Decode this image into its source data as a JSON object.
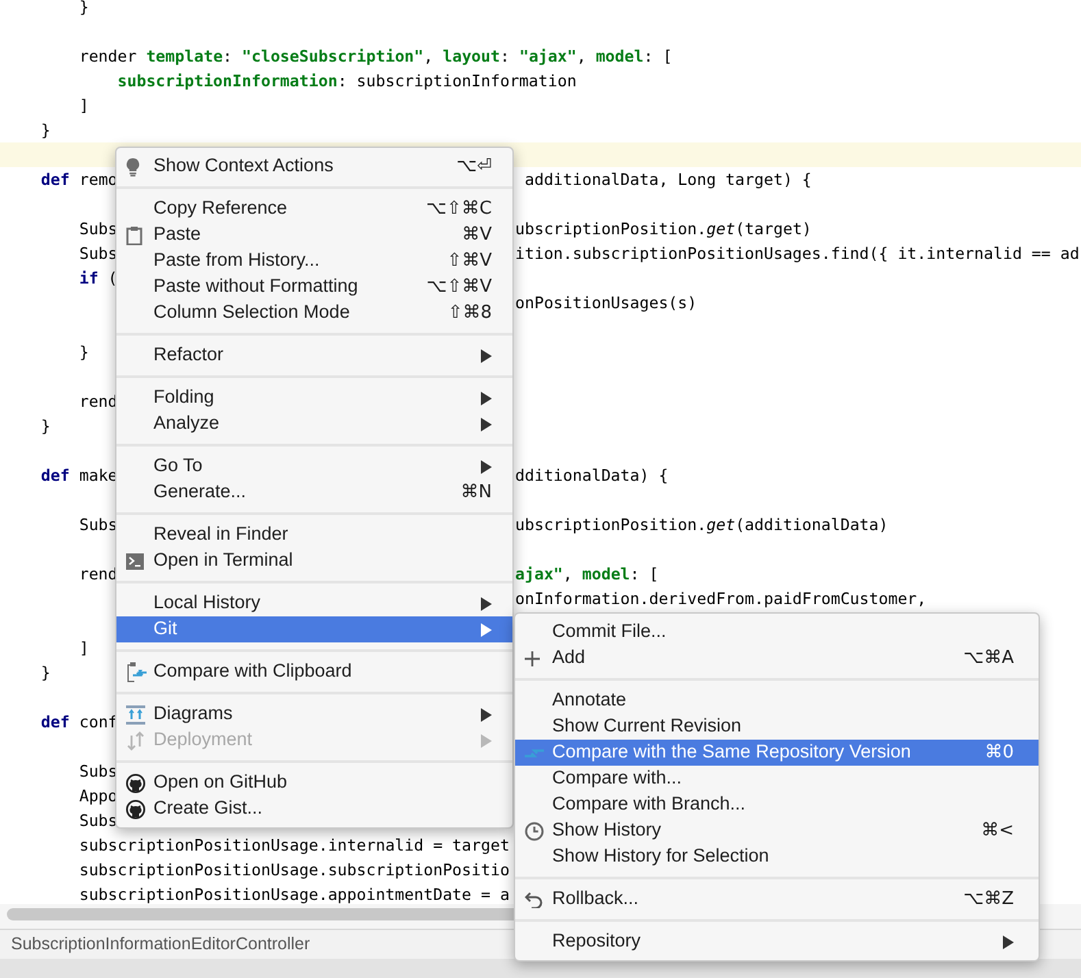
{
  "editor": {
    "lines": [
      {
        "kind": "code",
        "current": false,
        "left": [
          {
            "t": "        }"
          }
        ]
      },
      {
        "kind": "blank",
        "current": false
      },
      {
        "kind": "code",
        "current": false,
        "left": [
          {
            "t": "        render "
          },
          {
            "t": "template",
            "kind": "key"
          },
          {
            "t": ": "
          },
          {
            "t": "\"closeSubscription\"",
            "kind": "str"
          },
          {
            "t": ", "
          },
          {
            "t": "layout",
            "kind": "key"
          },
          {
            "t": ": "
          },
          {
            "t": "\"ajax\"",
            "kind": "str"
          },
          {
            "t": ", "
          },
          {
            "t": "model",
            "kind": "key"
          },
          {
            "t": ": ["
          }
        ]
      },
      {
        "kind": "code",
        "current": false,
        "left": [
          {
            "t": "            subscriptionInformation",
            "kind": "key"
          },
          {
            "t": ": subscriptionInformation"
          }
        ]
      },
      {
        "kind": "code",
        "current": false,
        "left": [
          {
            "t": "        ]"
          }
        ]
      },
      {
        "kind": "code",
        "current": false,
        "left": [
          {
            "t": "    }"
          }
        ]
      },
      {
        "kind": "blank",
        "current": true
      },
      {
        "kind": "code",
        "current": false,
        "left": [
          {
            "t": "    def",
            "kind": "kw"
          },
          {
            "t": " remo"
          }
        ],
        "right": [
          {
            "t": " additionalData, Long target) {"
          }
        ]
      },
      {
        "kind": "blank",
        "current": false
      },
      {
        "kind": "code",
        "current": false,
        "left": [
          {
            "t": "        Subs"
          }
        ],
        "right": [
          {
            "t": "ubscriptionPosition."
          },
          {
            "t": "get",
            "kind": "it"
          },
          {
            "t": "(target)"
          }
        ]
      },
      {
        "kind": "code",
        "current": false,
        "left": [
          {
            "t": "        Subs"
          }
        ],
        "right": [
          {
            "t": "ition.subscriptionPositionUsages.find({ it.internalid == ad"
          }
        ]
      },
      {
        "kind": "code",
        "current": false,
        "left": [
          {
            "t": "        if",
            "kind": "kw"
          },
          {
            "t": " ("
          }
        ]
      },
      {
        "kind": "code",
        "current": false,
        "right": [
          {
            "t": "onPositionUsages(s)"
          }
        ]
      },
      {
        "kind": "blank",
        "current": false
      },
      {
        "kind": "code",
        "current": false,
        "left": [
          {
            "t": "        }"
          }
        ]
      },
      {
        "kind": "blank",
        "current": false
      },
      {
        "kind": "code",
        "current": false,
        "left": [
          {
            "t": "        rend"
          }
        ]
      },
      {
        "kind": "code",
        "current": false,
        "left": [
          {
            "t": "    }"
          }
        ]
      },
      {
        "kind": "blank",
        "current": false
      },
      {
        "kind": "code",
        "current": false,
        "left": [
          {
            "t": "    def",
            "kind": "kw"
          },
          {
            "t": " make"
          }
        ],
        "right": [
          {
            "t": "dditionalData) {"
          }
        ]
      },
      {
        "kind": "blank",
        "current": false
      },
      {
        "kind": "code",
        "current": false,
        "left": [
          {
            "t": "        Subs"
          }
        ],
        "right": [
          {
            "t": "ubscriptionPosition."
          },
          {
            "t": "get",
            "kind": "it"
          },
          {
            "t": "(additionalData)"
          }
        ]
      },
      {
        "kind": "blank",
        "current": false
      },
      {
        "kind": "code",
        "current": false,
        "left": [
          {
            "t": "        rend"
          }
        ],
        "right": [
          {
            "t": "ajax\"",
            "kind": "str"
          },
          {
            "t": ", "
          },
          {
            "t": "model",
            "kind": "key"
          },
          {
            "t": ": ["
          }
        ]
      },
      {
        "kind": "code",
        "current": false,
        "right": [
          {
            "t": "onInformation.derivedFrom.paidFromCustomer,"
          }
        ]
      },
      {
        "kind": "blank",
        "current": false
      },
      {
        "kind": "code",
        "current": false,
        "left": [
          {
            "t": "        ]"
          }
        ]
      },
      {
        "kind": "code",
        "current": false,
        "left": [
          {
            "t": "    }"
          }
        ]
      },
      {
        "kind": "blank",
        "current": false
      },
      {
        "kind": "code",
        "current": false,
        "left": [
          {
            "t": "    def",
            "kind": "kw"
          },
          {
            "t": " conf"
          }
        ]
      },
      {
        "kind": "blank",
        "current": false
      },
      {
        "kind": "code",
        "current": false,
        "left": [
          {
            "t": "        Subs"
          }
        ]
      },
      {
        "kind": "code",
        "current": false,
        "left": [
          {
            "t": "        Appo"
          }
        ]
      },
      {
        "kind": "code",
        "current": false,
        "left": [
          {
            "t": "        Subs"
          }
        ]
      },
      {
        "kind": "code",
        "current": false,
        "left": [
          {
            "t": "        subscriptionPositionUsage.internalid = target"
          }
        ]
      },
      {
        "kind": "code",
        "current": false,
        "left": [
          {
            "t": "        subscriptionPositionUsage.subscriptionPositio"
          }
        ]
      },
      {
        "kind": "code",
        "current": false,
        "left": [
          {
            "t": "        subscriptionPositionUsage.appointmentDate = a"
          }
        ]
      }
    ]
  },
  "context_menu": {
    "sections": [
      [
        {
          "label": "Show Context Actions",
          "shortcut": "⌥⏎",
          "has_submenu": false,
          "selected": false,
          "disabled": false
        }
      ],
      [
        {
          "label": "Copy Reference",
          "shortcut": "⌥⇧⌘C",
          "has_submenu": false,
          "selected": false,
          "disabled": false
        },
        {
          "label": "Paste",
          "shortcut": "⌘V",
          "has_submenu": false,
          "selected": false,
          "disabled": false
        },
        {
          "label": "Paste from History...",
          "shortcut": "⇧⌘V",
          "has_submenu": false,
          "selected": false,
          "disabled": false
        },
        {
          "label": "Paste without Formatting",
          "shortcut": "⌥⇧⌘V",
          "has_submenu": false,
          "selected": false,
          "disabled": false
        },
        {
          "label": "Column Selection Mode",
          "shortcut": "⇧⌘8",
          "has_submenu": false,
          "selected": false,
          "disabled": false
        }
      ],
      [
        {
          "label": "Refactor",
          "has_submenu": true,
          "selected": false,
          "disabled": false
        }
      ],
      [
        {
          "label": "Folding",
          "has_submenu": true,
          "selected": false,
          "disabled": false
        },
        {
          "label": "Analyze",
          "has_submenu": true,
          "selected": false,
          "disabled": false
        }
      ],
      [
        {
          "label": "Go To",
          "has_submenu": true,
          "selected": false,
          "disabled": false
        },
        {
          "label": "Generate...",
          "shortcut": "⌘N",
          "has_submenu": false,
          "selected": false,
          "disabled": false
        }
      ],
      [
        {
          "label": "Reveal in Finder",
          "has_submenu": false,
          "selected": false,
          "disabled": false
        },
        {
          "label": "Open in Terminal",
          "has_submenu": false,
          "selected": false,
          "disabled": false
        }
      ],
      [
        {
          "label": "Local History",
          "has_submenu": true,
          "selected": false,
          "disabled": false
        },
        {
          "label": "Git",
          "has_submenu": true,
          "selected": true,
          "disabled": false
        }
      ],
      [
        {
          "label": "Compare with Clipboard",
          "has_submenu": false,
          "selected": false,
          "disabled": false
        }
      ],
      [
        {
          "label": "Diagrams",
          "has_submenu": true,
          "selected": false,
          "disabled": false
        },
        {
          "label": "Deployment",
          "has_submenu": true,
          "selected": false,
          "disabled": true
        }
      ],
      [
        {
          "label": "Open on GitHub",
          "has_submenu": false,
          "selected": false,
          "disabled": false
        },
        {
          "label": "Create Gist...",
          "has_submenu": false,
          "selected": false,
          "disabled": false
        }
      ]
    ]
  },
  "git_submenu": {
    "sections": [
      [
        {
          "label": "Commit File...",
          "has_submenu": false,
          "selected": false,
          "disabled": false
        },
        {
          "label": "Add",
          "shortcut": "⌥⌘A",
          "has_submenu": false,
          "selected": false,
          "disabled": false
        }
      ],
      [
        {
          "label": "Annotate",
          "has_submenu": false,
          "selected": false,
          "disabled": false
        },
        {
          "label": "Show Current Revision",
          "has_submenu": false,
          "selected": false,
          "disabled": false
        },
        {
          "label": "Compare with the Same Repository Version",
          "shortcut": "⌘0",
          "has_submenu": false,
          "selected": true,
          "disabled": false
        },
        {
          "label": "Compare with...",
          "has_submenu": false,
          "selected": false,
          "disabled": false
        },
        {
          "label": "Compare with Branch...",
          "has_submenu": false,
          "selected": false,
          "disabled": false
        },
        {
          "label": "Show History",
          "shortcut": "⌘<",
          "has_submenu": false,
          "selected": false,
          "disabled": false
        },
        {
          "label": "Show History for Selection",
          "has_submenu": false,
          "selected": false,
          "disabled": false
        }
      ],
      [
        {
          "label": "Rollback...",
          "shortcut": "⌥⌘Z",
          "has_submenu": false,
          "selected": false,
          "disabled": false
        }
      ],
      [
        {
          "label": "Repository",
          "has_submenu": true,
          "selected": false,
          "disabled": false
        }
      ]
    ]
  },
  "status_bar": {
    "breadcrumb": "SubscriptionInformationEditorController"
  }
}
